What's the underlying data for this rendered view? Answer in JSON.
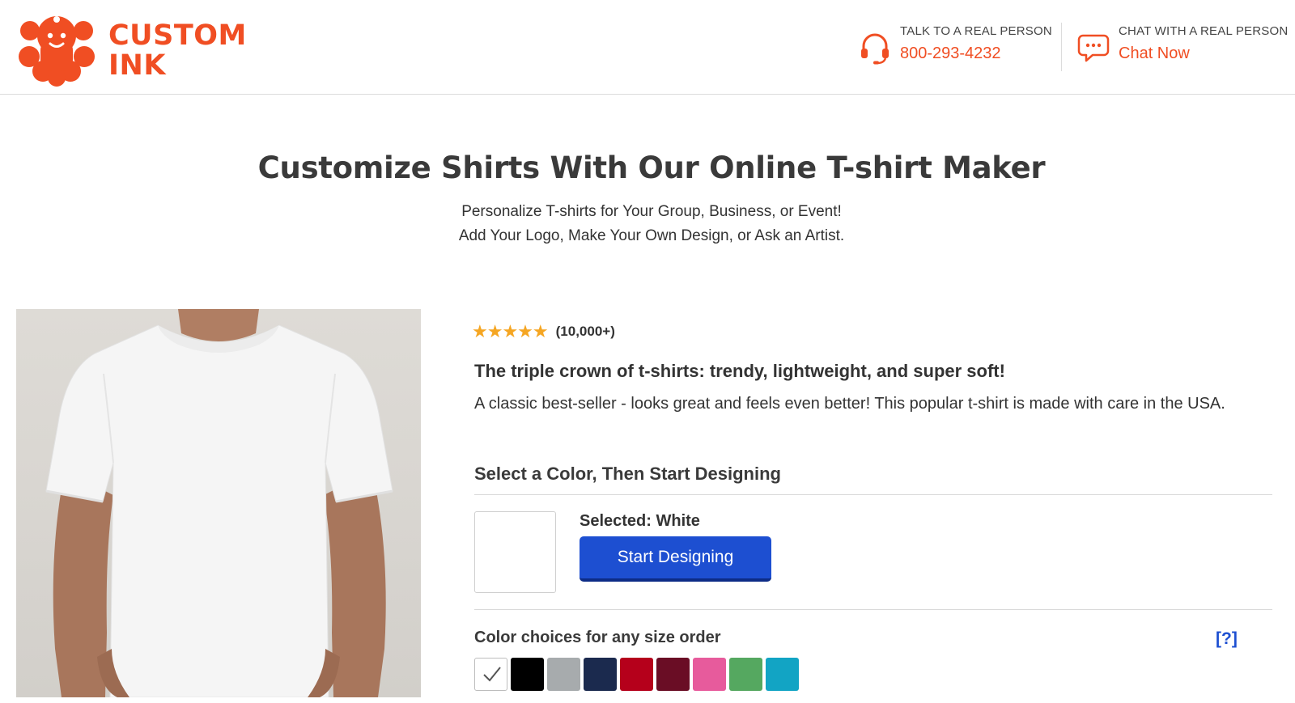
{
  "brand": {
    "line1": "CUSTOM",
    "line2": "INK",
    "color": "#f04e23"
  },
  "header": {
    "phone": {
      "label": "TALK TO A REAL PERSON",
      "value": "800-293-4232",
      "icon": "headset-icon"
    },
    "chat": {
      "label": "CHAT WITH A REAL PERSON",
      "value": "Chat Now",
      "icon": "chat-bubble-icon"
    }
  },
  "hero": {
    "title": "Customize Shirts With Our Online T-shirt Maker",
    "subtitle_line1": "Personalize T-shirts for Your Group, Business, or Event!",
    "subtitle_line2": "Add Your Logo, Make Your Own Design, or Ask an Artist."
  },
  "product": {
    "image_icon": "white-tshirt-photo",
    "rating_value": 4.5,
    "stars": "★★★★★",
    "rating_count": "(10,000+)",
    "tagline": "The triple crown of t-shirts: trendy, lightweight, and super soft!",
    "description": "A classic best-seller - looks great and feels even better! This popular t-shirt is made with care in the USA."
  },
  "selection": {
    "section_title": "Select a Color, Then Start Designing",
    "selected_label": "Selected: White",
    "start_button": "Start Designing"
  },
  "colors": {
    "title": "Color choices for any size order",
    "help": "[?]",
    "swatches": [
      {
        "name": "White",
        "hex": "#ffffff",
        "selected": true
      },
      {
        "name": "Black",
        "hex": "#000000",
        "selected": false
      },
      {
        "name": "Gray",
        "hex": "#a7abad",
        "selected": false
      },
      {
        "name": "Navy",
        "hex": "#1b2a4e",
        "selected": false
      },
      {
        "name": "Red",
        "hex": "#b5001b",
        "selected": false
      },
      {
        "name": "Maroon",
        "hex": "#6a0d25",
        "selected": false
      },
      {
        "name": "Pink",
        "hex": "#e75b9c",
        "selected": false
      },
      {
        "name": "Green",
        "hex": "#55a860",
        "selected": false
      },
      {
        "name": "Teal",
        "hex": "#12a4c4",
        "selected": false
      }
    ]
  },
  "accent_colors": {
    "brand_orange": "#f04e23",
    "button_blue": "#1d4fd1",
    "star_gold": "#f5a623"
  }
}
